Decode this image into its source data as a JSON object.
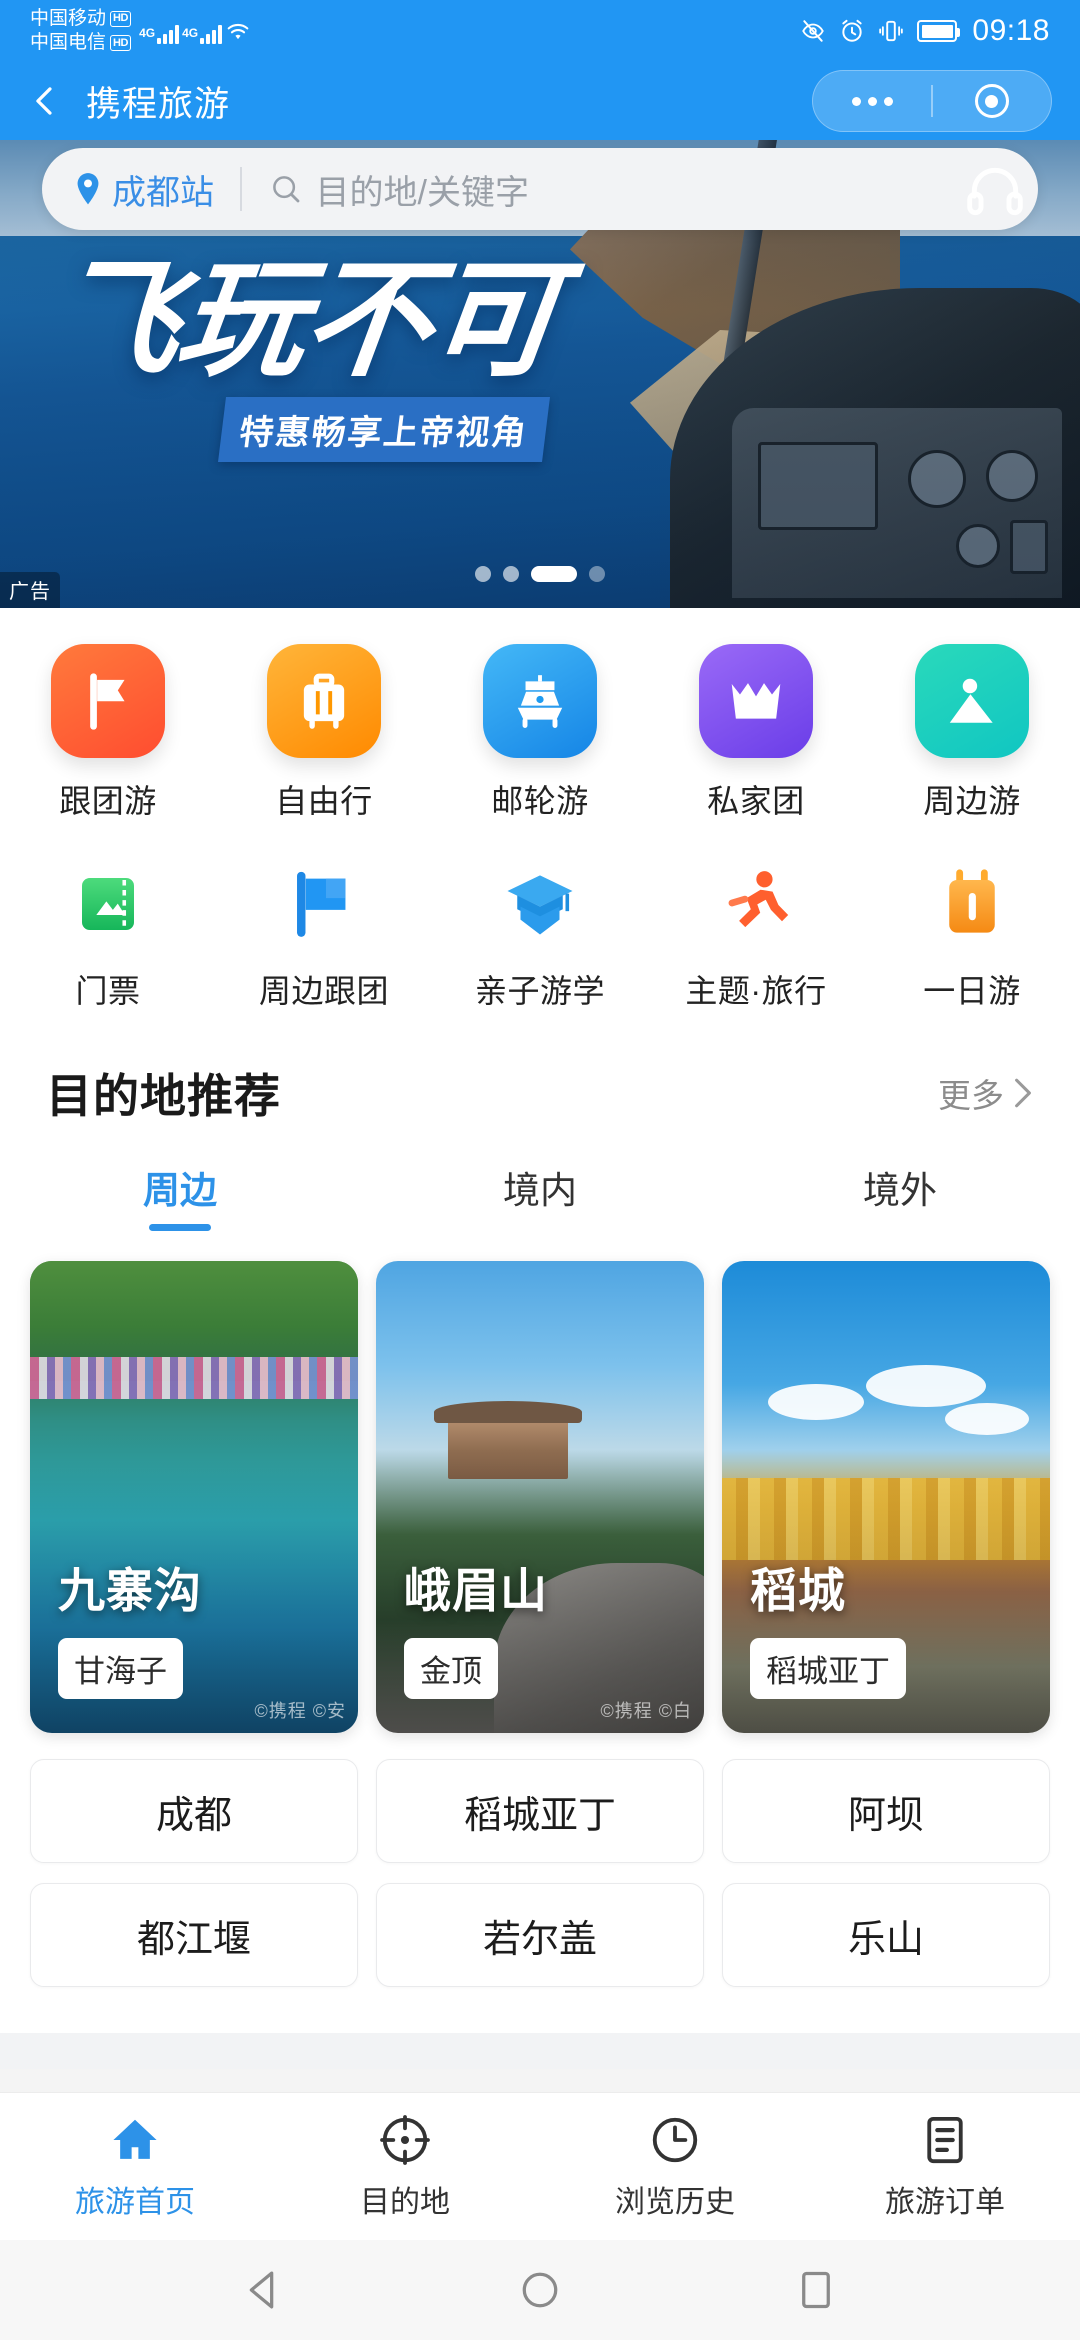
{
  "status_bar": {
    "carriers": [
      {
        "name": "中国移动",
        "badge": "HD"
      },
      {
        "name": "中国电信",
        "badge": "HD"
      }
    ],
    "network_labels": [
      "4G",
      "4G"
    ],
    "time": "09:18",
    "icons": [
      "eye-off-icon",
      "alarm-icon",
      "vibrate-icon",
      "battery-icon",
      "wifi-icon"
    ]
  },
  "header": {
    "back_icon": "back-chevron-icon",
    "title": "携程旅游",
    "capsule": {
      "more_icon": "more-dots-icon",
      "target_icon": "miniprogram-close-icon"
    }
  },
  "search": {
    "location_icon": "location-pin-icon",
    "city": "成都站",
    "search_icon": "search-icon",
    "placeholder": "目的地/关键字",
    "service_icon": "headset-icon"
  },
  "banner": {
    "title": "飞玩不可",
    "subtitle": "特惠畅享上帝视角",
    "ad_label": "广告",
    "dots_total": 4,
    "dots_active_index": 2
  },
  "quick_nav": {
    "row1": [
      {
        "label": "跟团游",
        "icon": "flag-icon",
        "color": "#ff5c38",
        "color2": "#ff7a3c"
      },
      {
        "label": "自由行",
        "icon": "suitcase-icon",
        "color": "#ff9800",
        "color2": "#ffb300"
      },
      {
        "label": "邮轮游",
        "icon": "cruise-ship-icon",
        "color": "#1e9bf0",
        "color2": "#44b8f7"
      },
      {
        "label": "私家团",
        "icon": "crown-icon",
        "color": "#7a4ff0",
        "color2": "#9a6af7"
      },
      {
        "label": "周边游",
        "icon": "mountain-icon",
        "color": "#16cfc0",
        "color2": "#2ad9bb"
      }
    ],
    "row2": [
      {
        "label": "门票",
        "icon": "ticket-icon",
        "color": "#2bc46a"
      },
      {
        "label": "周边跟团",
        "icon": "blue-flag-icon",
        "color": "#2196f3"
      },
      {
        "label": "亲子游学",
        "icon": "graduation-cap-icon",
        "color": "#2aa6f0"
      },
      {
        "label": "主题·旅行",
        "icon": "runner-icon",
        "color": "#ff5f2e"
      },
      {
        "label": "一日游",
        "icon": "calendar-icon",
        "color": "#ff9b21"
      }
    ]
  },
  "destination": {
    "title": "目的地推荐",
    "more_label": "更多",
    "more_icon": "chevron-right-icon",
    "tabs": [
      {
        "label": "周边",
        "active": true
      },
      {
        "label": "境内",
        "active": false
      },
      {
        "label": "境外",
        "active": false
      }
    ],
    "cards": [
      {
        "name": "九寨沟",
        "tag": "甘海子",
        "watermark": "©携程 ©安"
      },
      {
        "name": "峨眉山",
        "tag": "金顶",
        "watermark": "©携程 ©白"
      },
      {
        "name": "稻城",
        "tag": "稻城亚丁",
        "watermark": ""
      }
    ],
    "chips": [
      [
        "成都",
        "稻城亚丁",
        "阿坝"
      ],
      [
        "都江堰",
        "若尔盖",
        "乐山"
      ]
    ]
  },
  "bottom_nav": [
    {
      "label": "旅游首页",
      "icon": "home-icon",
      "active": true
    },
    {
      "label": "目的地",
      "icon": "compass-icon",
      "active": false
    },
    {
      "label": "浏览历史",
      "icon": "clock-icon",
      "active": false
    },
    {
      "label": "旅游订单",
      "icon": "order-list-icon",
      "active": false
    }
  ],
  "android_nav": {
    "back_icon": "android-back-icon",
    "home_icon": "android-home-icon",
    "recents_icon": "android-recents-icon"
  },
  "colors": {
    "brand_blue": "#2196f3",
    "accent_blue": "#2d92e8",
    "page_bg": "#f2f3f5"
  }
}
